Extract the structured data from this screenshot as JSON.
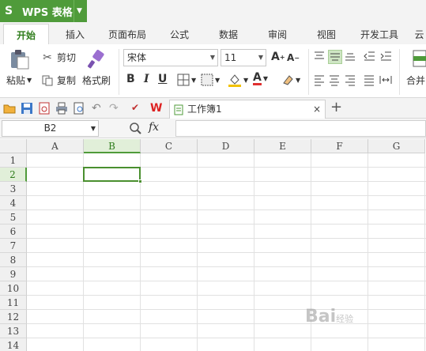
{
  "app": {
    "name": "WPS 表格",
    "logo": "S"
  },
  "tabs": [
    {
      "label": "开始",
      "active": true
    },
    {
      "label": "插入"
    },
    {
      "label": "页面布局"
    },
    {
      "label": "公式"
    },
    {
      "label": "数据"
    },
    {
      "label": "审阅"
    },
    {
      "label": "视图"
    },
    {
      "label": "开发工具"
    },
    {
      "label": "云"
    }
  ],
  "ribbon": {
    "paste": "粘贴",
    "cut": "剪切",
    "copy": "复制",
    "format_painter": "格式刷",
    "font_name": "宋体",
    "font_size": "11",
    "bold": "B",
    "italic": "I",
    "underline": "U",
    "merge": "合并"
  },
  "quickbar": {
    "doc_tab": "工作簿1",
    "close": "×",
    "new_tab": "+"
  },
  "formula_bar": {
    "name_box": "B2",
    "fx": "fx",
    "formula": ""
  },
  "grid": {
    "columns": [
      "A",
      "B",
      "C",
      "D",
      "E",
      "F",
      "G"
    ],
    "rows": [
      "1",
      "2",
      "3",
      "4",
      "5",
      "6",
      "7",
      "8",
      "9",
      "10",
      "11",
      "12",
      "13",
      "14"
    ],
    "active_cell": "B2"
  },
  "watermark": {
    "text": "Bai",
    "suffix": "经验"
  },
  "colors": {
    "accent": "#4f9b3a",
    "active_tab": "#2f7d1c"
  }
}
